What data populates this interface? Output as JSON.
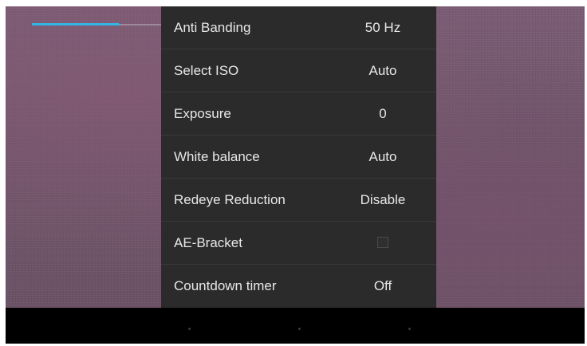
{
  "zoom": {
    "level": 0.67,
    "accent_color": "#33b5e5"
  },
  "settings": {
    "rows": [
      {
        "label": "Anti Banding",
        "value": "50 Hz"
      },
      {
        "label": "Select ISO",
        "value": "Auto"
      },
      {
        "label": "Exposure",
        "value": "0"
      },
      {
        "label": "White balance",
        "value": "Auto"
      },
      {
        "label": "Redeye Reduction",
        "value": "Disable"
      },
      {
        "label": "AE-Bracket",
        "checked": false
      },
      {
        "label": "Countdown timer",
        "value": "Off"
      }
    ]
  },
  "navbar": {
    "buttons": [
      "back-icon",
      "home-icon",
      "recent-apps-icon"
    ]
  }
}
